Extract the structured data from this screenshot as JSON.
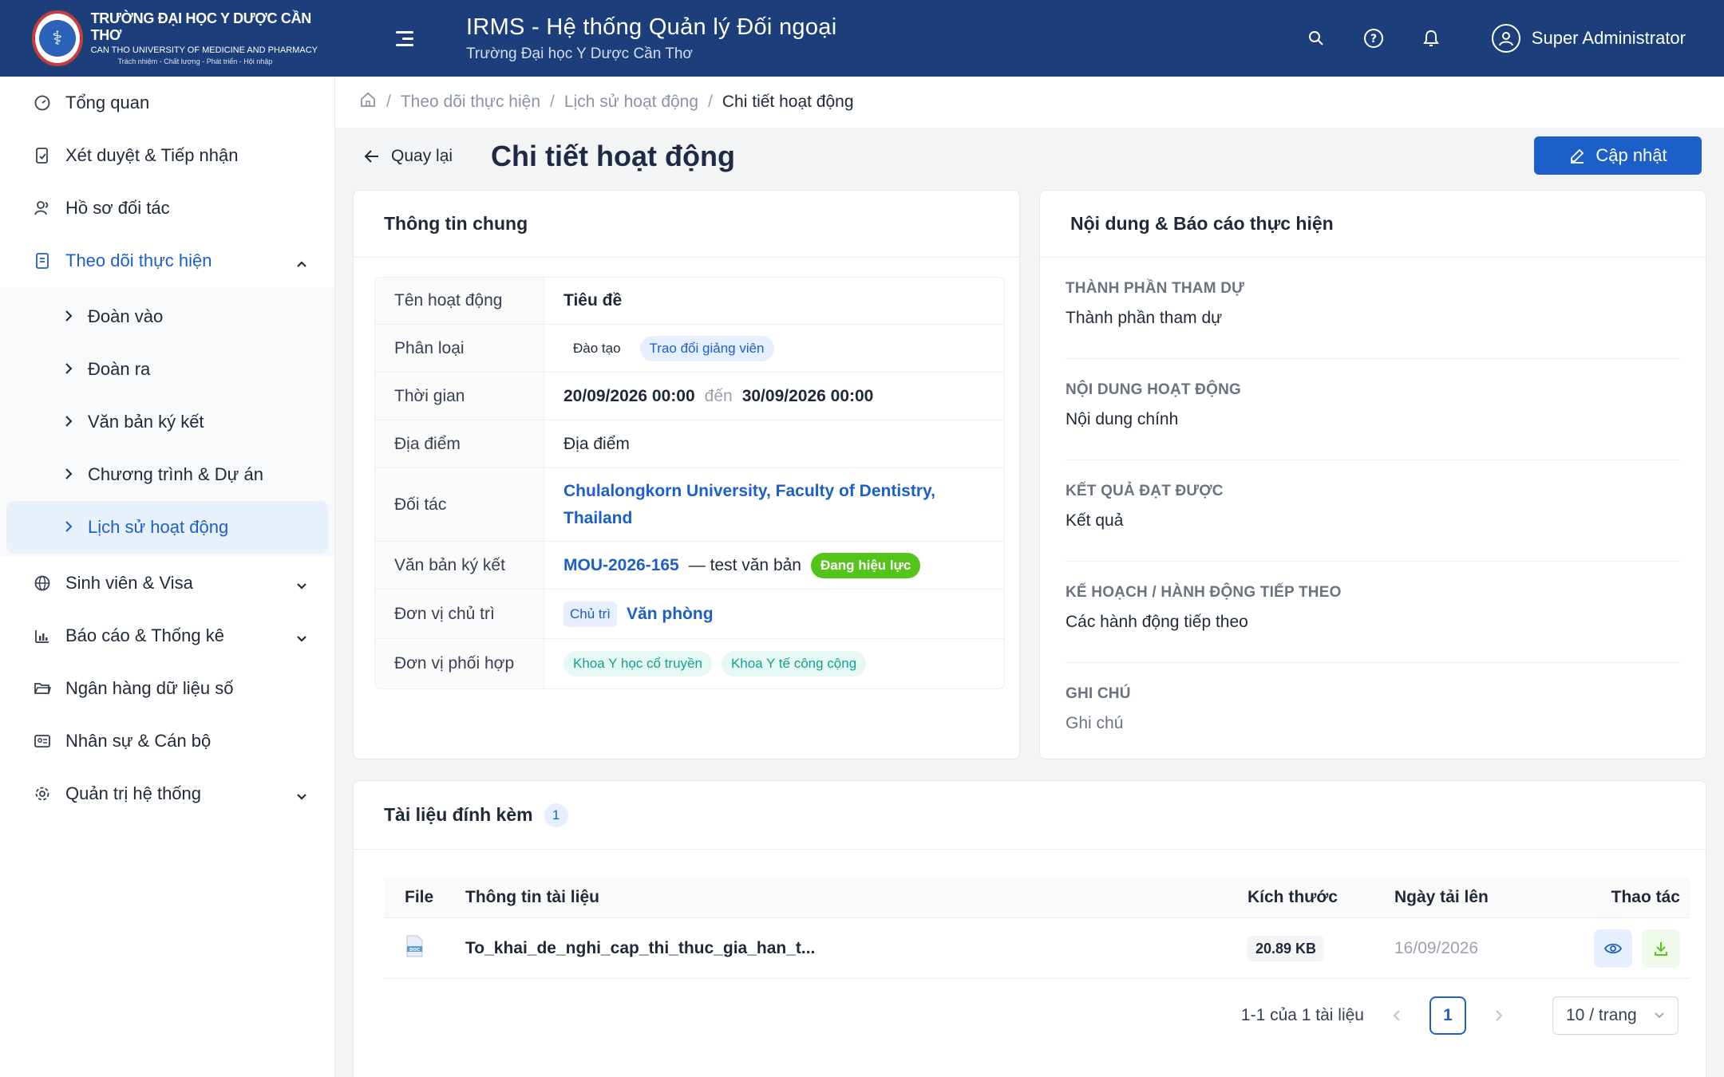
{
  "header": {
    "logo_line1": "TRƯỜNG ĐẠI HỌC Y DƯỢC CẦN THƠ",
    "logo_line2": "CAN THO UNIVERSITY OF MEDICINE AND PHARMACY",
    "logo_line3": "Trách nhiệm - Chất lượng - Phát triển - Hội nhập",
    "app_title": "IRMS - Hệ thống Quản lý Đối ngoại",
    "app_subtitle": "Trường Đại học Y Dược Cần Thơ",
    "user_name": "Super Administrator"
  },
  "sidebar": {
    "items": [
      {
        "label": "Tổng quan",
        "icon": "dashboard-icon"
      },
      {
        "label": "Xét duyệt & Tiếp nhận",
        "icon": "document-check-icon"
      },
      {
        "label": "Hồ sơ đối tác",
        "icon": "users-icon"
      },
      {
        "label": "Theo dõi thực hiện",
        "icon": "tracking-icon",
        "expanded": true
      }
    ],
    "subitems": [
      "Đoàn vào",
      "Đoàn ra",
      "Văn bản ký kết",
      "Chương trình & Dự án",
      "Lịch sử hoạt động"
    ],
    "items_after": [
      {
        "label": "Sinh viên & Visa",
        "icon": "globe-icon"
      },
      {
        "label": "Báo cáo & Thống kê",
        "icon": "bar-chart-icon"
      },
      {
        "label": "Ngân hàng dữ liệu số",
        "icon": "folder-open-icon"
      },
      {
        "label": "Nhân sự & Cán bộ",
        "icon": "id-card-icon"
      },
      {
        "label": "Quản trị hệ thống",
        "icon": "gear-icon"
      }
    ]
  },
  "breadcrumb": {
    "items": [
      "Theo dõi thực hiện",
      "Lịch sử hoạt động"
    ],
    "current": "Chi tiết hoạt động"
  },
  "page": {
    "back_label": "Quay lại",
    "title": "Chi tiết hoạt động",
    "update_label": "Cập nhật"
  },
  "general": {
    "title": "Thông tin chung",
    "labels": {
      "name": "Tên hoạt động",
      "category": "Phân loại",
      "time": "Thời gian",
      "location": "Địa điểm",
      "partner": "Đối tác",
      "agreement": "Văn bản ký kết",
      "host": "Đơn vị chủ trì",
      "coop": "Đơn vị phối hợp"
    },
    "name": "Tiêu đề",
    "category_tags": [
      "Đào tạo",
      "Trao đổi giảng viên"
    ],
    "time_start": "20/09/2026 00:00",
    "time_sep": "đến",
    "time_end": "30/09/2026 00:00",
    "location": "Địa điểm",
    "partner_line1": "Chulalongkorn University, Faculty of Dentistry,",
    "partner_line2": "Thailand",
    "agreement_code": "MOU-2026-165",
    "agreement_desc": "— test văn bản",
    "agreement_status": "Đang hiệu lực",
    "host_tag": "Chủ trì",
    "host_name": "Văn phòng",
    "coop_tags": [
      "Khoa Y học cổ truyền",
      "Khoa Y tế công cộng"
    ]
  },
  "report": {
    "title": "Nội dung & Báo cáo thực hiện",
    "sections": [
      {
        "label": "THÀNH PHẦN THAM DỰ",
        "value": "Thành phần tham dự"
      },
      {
        "label": "NỘI DUNG HOẠT ĐỘNG",
        "value": "Nội dung chính"
      },
      {
        "label": "KẾT QUẢ ĐẠT ĐƯỢC",
        "value": "Kết quả"
      },
      {
        "label": "KẾ HOẠCH / HÀNH ĐỘNG TIẾP THEO",
        "value": "Các hành động tiếp theo"
      },
      {
        "label": "GHI CHÚ",
        "value": "Ghi chú"
      }
    ]
  },
  "attachments": {
    "title": "Tài liệu đính kèm",
    "count": "1",
    "columns": [
      "File",
      "Thông tin tài liệu",
      "Kích thước",
      "Ngày tải lên",
      "Thao tác"
    ],
    "rows": [
      {
        "name": "To_khai_de_nghi_cap_thi_thuc_gia_han_t...",
        "size": "20.89 KB",
        "date": "16/09/2026",
        "file_icon": "doc-file-icon"
      }
    ],
    "pagination_summary": "1-1 của 1 tài liệu",
    "current_page": "1",
    "page_size": "10 / trang"
  },
  "colors": {
    "header_bg": "#1c3f7c",
    "accent": "#1d5fc9",
    "success": "#52c41a"
  }
}
